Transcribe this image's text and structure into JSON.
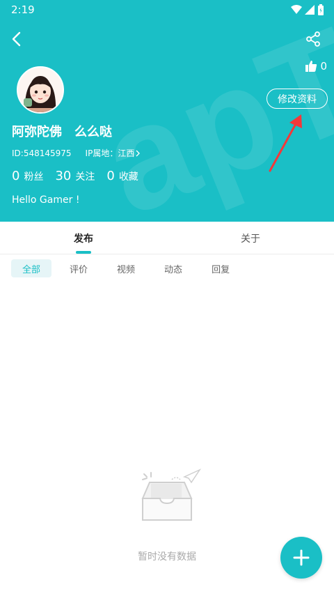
{
  "status_bar": {
    "time": "2:19"
  },
  "profile": {
    "username": "阿弥陀佛　么么哒",
    "id_text": "ID:548145975",
    "ip_text": "IP属地：江西",
    "like_count": "0",
    "edit_label": "修改资料",
    "bio": "Hello Gamer !"
  },
  "stats": [
    {
      "num": "0",
      "label": "粉丝"
    },
    {
      "num": "30",
      "label": "关注"
    },
    {
      "num": "0",
      "label": "收藏"
    }
  ],
  "tabs": [
    {
      "label": "发布"
    },
    {
      "label": "关于"
    }
  ],
  "subtabs": [
    {
      "label": "全部"
    },
    {
      "label": "评价"
    },
    {
      "label": "视频"
    },
    {
      "label": "动态"
    },
    {
      "label": "回复"
    }
  ],
  "empty": {
    "text": "暂时没有数据"
  },
  "colors": {
    "accent": "#1abfc6",
    "arrow": "#f4383a"
  }
}
